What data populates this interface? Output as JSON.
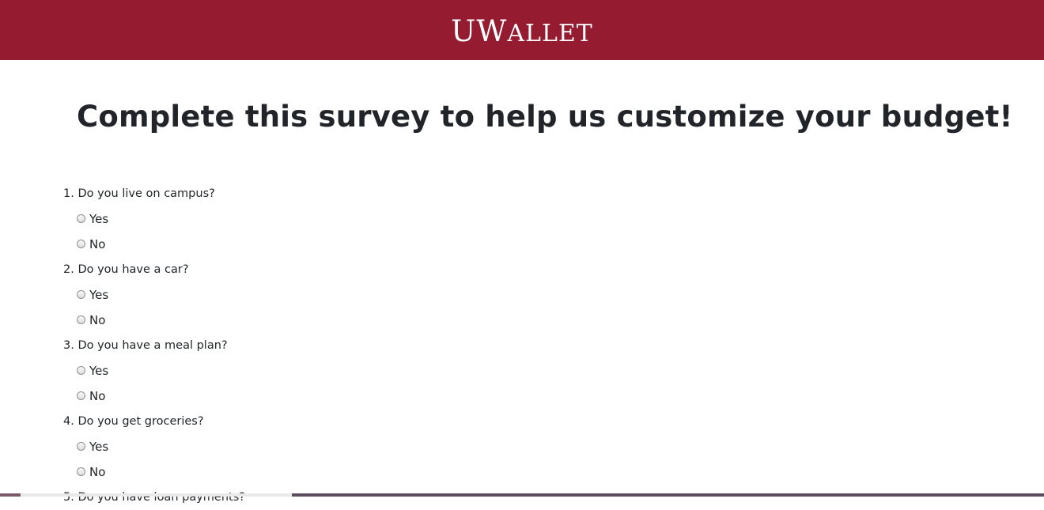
{
  "header": {
    "brand_first": "U",
    "brand_w": "W",
    "brand_rest": "ALLET",
    "background": "#951b31"
  },
  "page": {
    "title": "Complete this survey to help us customize your budget!"
  },
  "survey": {
    "questions": [
      {
        "number": "1.",
        "text": "Do you live on campus?",
        "options": [
          "Yes",
          "No"
        ]
      },
      {
        "number": "2.",
        "text": "Do you have a car?",
        "options": [
          "Yes",
          "No"
        ]
      },
      {
        "number": "3.",
        "text": "Do you have a meal plan?",
        "options": [
          "Yes",
          "No"
        ]
      },
      {
        "number": "4.",
        "text": "Do you get groceries?",
        "options": [
          "Yes",
          "No"
        ]
      },
      {
        "number": "5.",
        "text": "Do you have loan payments?",
        "options": []
      }
    ]
  }
}
